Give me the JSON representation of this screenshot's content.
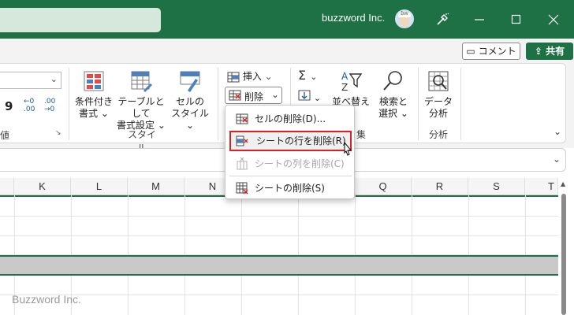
{
  "titlebar": {
    "org_name": "buzzword Inc.",
    "avatar_initials": "BW"
  },
  "header_buttons": {
    "comment": "コメント",
    "share": "共有"
  },
  "ribbon": {
    "number_label_partial": "値",
    "comma_glyph": "9",
    "decimal_inc": "←0\n.00",
    "decimal_dec": ".00\n→0",
    "styles": {
      "conditional_format_line1": "条件付き",
      "conditional_format_line2": "書式",
      "table_format_line1": "テーブルとして",
      "table_format_line2": "書式設定",
      "cell_style_line1": "セルの",
      "cell_style_line2": "スタイル",
      "group_label": "スタイル"
    },
    "cells": {
      "insert": "挿入",
      "delete": "削除"
    },
    "editing": {
      "sort_filter_line1": "並べ替えと",
      "find_select_line1": "検索と",
      "find_select_line2": "選択",
      "group_label_partial": "集"
    },
    "analysis": {
      "data_analysis_line1": "データ",
      "data_analysis_line2": "分析",
      "group_label": "分析"
    }
  },
  "menu": {
    "items": [
      {
        "label": "セルの削除(D)...",
        "state": "enabled"
      },
      {
        "label": "シートの行を削除(R)",
        "state": "highlighted"
      },
      {
        "label": "シートの列を削除(C)",
        "state": "disabled"
      },
      {
        "label": "シートの削除(S)",
        "state": "enabled"
      }
    ]
  },
  "grid": {
    "columns": [
      "K",
      "L",
      "M",
      "N",
      "Q",
      "R",
      "S",
      "T"
    ]
  },
  "watermark": "Buzzword Inc.",
  "colors": {
    "accent": "#1e7145",
    "highlight_border": "#e02020",
    "selected_row": "#c9c9c9"
  }
}
